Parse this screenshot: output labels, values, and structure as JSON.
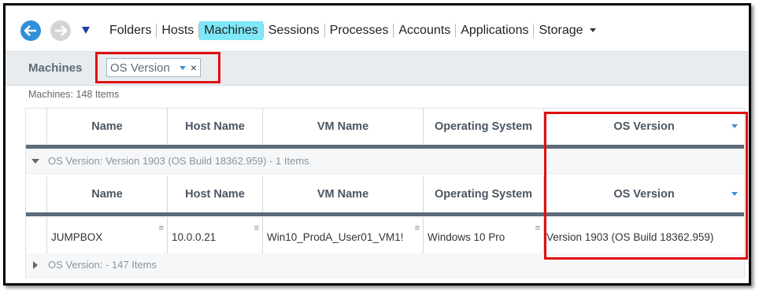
{
  "nav": {
    "menu": [
      "Folders",
      "Hosts",
      "Machines",
      "Sessions",
      "Processes",
      "Accounts",
      "Applications",
      "Storage"
    ],
    "active": "Machines"
  },
  "groupbar": {
    "label": "Machines",
    "chip_text": "OS Version",
    "chip_close": "×"
  },
  "count_text": "Machines: 148 Items",
  "columns": [
    "Name",
    "Host Name",
    "VM Name",
    "Operating System",
    "OS Version"
  ],
  "groups": [
    {
      "label": "OS Version: Version 1903 (OS Build 18362.959) - 1 Items",
      "expanded": true,
      "rows": [
        {
          "name": "JUMPBOX",
          "host": "10.0.0.21",
          "vm": "Win10_ProdA_User01_VM1!",
          "os": "Windows 10 Pro",
          "osver": "Version 1903 (OS Build 18362.959)"
        }
      ]
    },
    {
      "label": "OS Version:  - 147 Items",
      "expanded": false,
      "rows": []
    }
  ],
  "colors": {
    "accent": "#3e8fd6",
    "highlight": "#7ee8f8",
    "annotation": "#e01010",
    "header_rule": "#5d6b7a"
  }
}
